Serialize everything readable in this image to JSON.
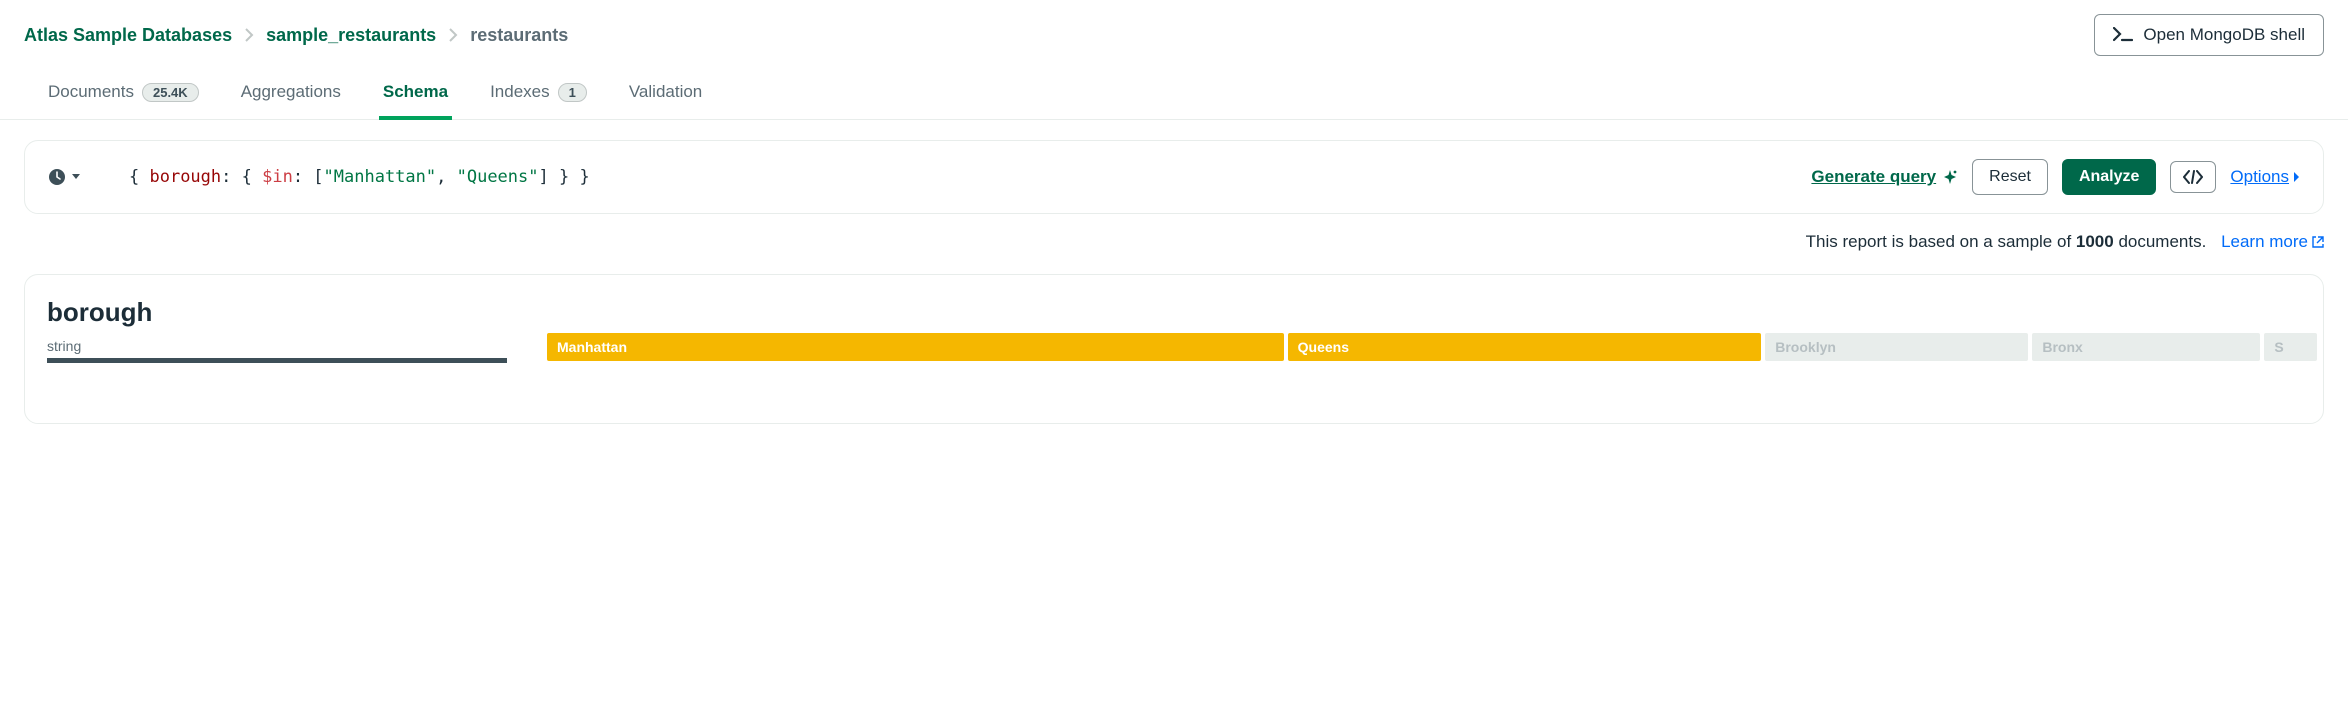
{
  "breadcrumb": {
    "root": "Atlas Sample Databases",
    "db": "sample_restaurants",
    "coll": "restaurants"
  },
  "shell_button": "Open MongoDB shell",
  "tabs": {
    "documents": "Documents",
    "documents_count": "25.4K",
    "aggregations": "Aggregations",
    "schema": "Schema",
    "indexes": "Indexes",
    "indexes_count": "1",
    "validation": "Validation"
  },
  "query": {
    "open": "{ ",
    "key": "borough",
    "sep1": ": { ",
    "op": "$in",
    "sep2": ": [",
    "v1": "\"Manhattan\"",
    "comma": ", ",
    "v2": "\"Queens\"",
    "close": "] } }"
  },
  "actions": {
    "generate": "Generate query",
    "reset": "Reset",
    "analyze": "Analyze",
    "options": "Options"
  },
  "report": {
    "prefix": "This report is based on a sample of ",
    "count": "1000",
    "suffix": " documents.",
    "learn": "Learn more"
  },
  "field": {
    "name": "borough",
    "type": "string",
    "values": [
      {
        "label": "Manhattan",
        "active": true,
        "width": 42
      },
      {
        "label": "Queens",
        "active": true,
        "width": 27
      },
      {
        "label": "Brooklyn",
        "active": false,
        "width": 15
      },
      {
        "label": "Bronx",
        "active": false,
        "width": 13
      },
      {
        "label": "S",
        "active": false,
        "width": 3
      }
    ]
  }
}
